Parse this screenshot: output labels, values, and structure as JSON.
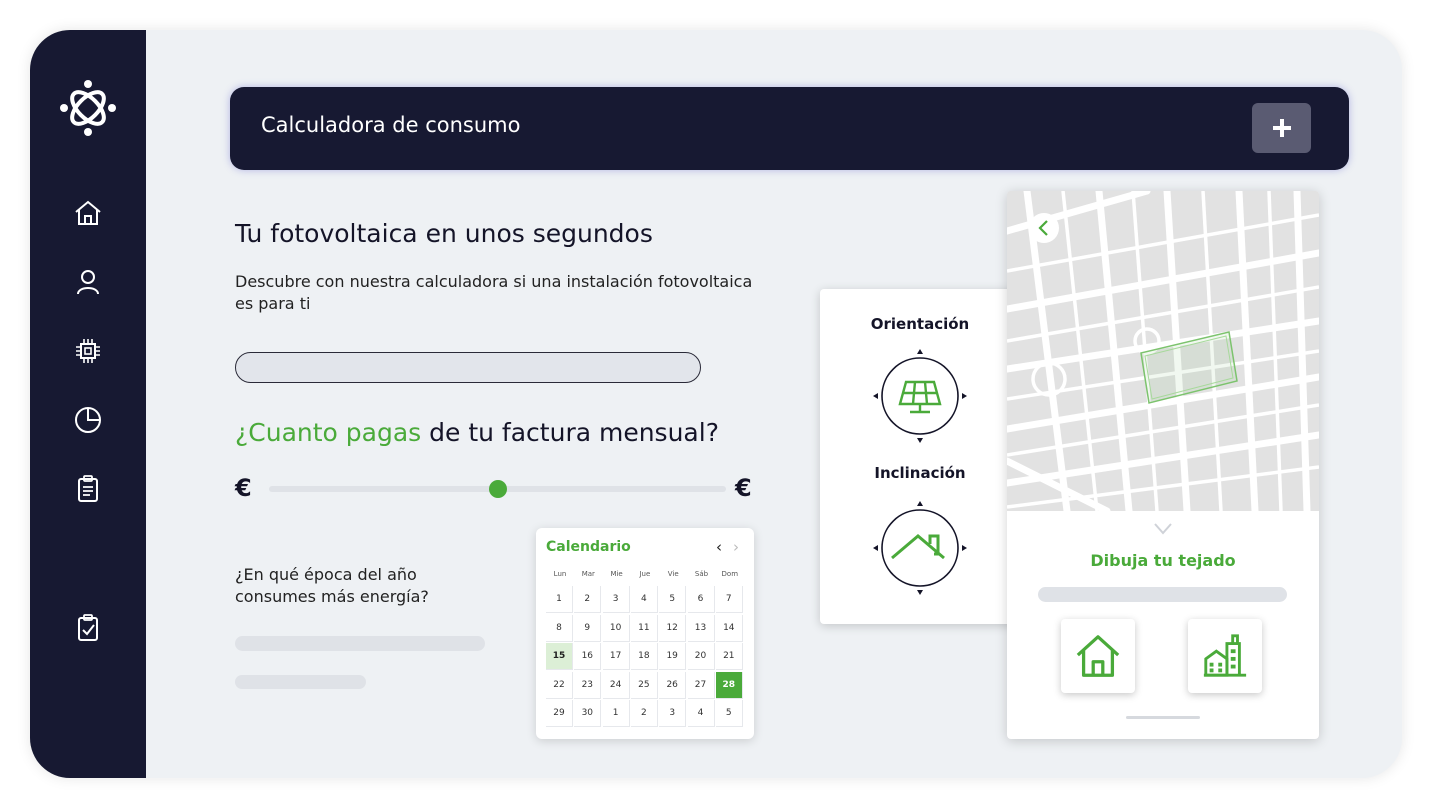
{
  "header": {
    "title": "Calculadora de consumo"
  },
  "main": {
    "title": "Tu fotovoltaica en unos segundos",
    "description": "Descubre con nuestra calculadora si una instalación fotovoltaica es para ti",
    "question_green": "¿Cuanto pagas",
    "question_rest": " de tu factura mensual?",
    "currency_left": "€",
    "currency_right": "€",
    "slider_value": 0.5,
    "season_question": "¿En qué época del año consumes más energía?"
  },
  "calendar": {
    "title": "Calendario",
    "prev": "‹",
    "next": "›",
    "weekdays": [
      "Lun",
      "Mar",
      "Mie",
      "Jue",
      "Vie",
      "Sáb",
      "Dom"
    ],
    "weeks": [
      [
        "1",
        "2",
        "3",
        "4",
        "5",
        "6",
        "7"
      ],
      [
        "8",
        "9",
        "10",
        "11",
        "12",
        "13",
        "14"
      ],
      [
        "15",
        "16",
        "17",
        "18",
        "19",
        "20",
        "21"
      ],
      [
        "22",
        "23",
        "24",
        "25",
        "26",
        "27",
        "28"
      ],
      [
        "29",
        "30",
        "1",
        "2",
        "3",
        "4",
        "5"
      ]
    ],
    "today": "15",
    "selected": "28"
  },
  "orientation_card": {
    "orientation_label": "Orientación",
    "inclination_label": "Inclinación"
  },
  "map_card": {
    "draw_label": "Dibuja tu tejado"
  },
  "icons": {
    "sidebar": [
      "logo-icon",
      "home-icon",
      "user-icon",
      "chip-icon",
      "pie-chart-icon",
      "clipboard-icon",
      "clipboard-check-icon"
    ],
    "accent_color": "#4aaa3a",
    "dark_color": "#171932"
  }
}
